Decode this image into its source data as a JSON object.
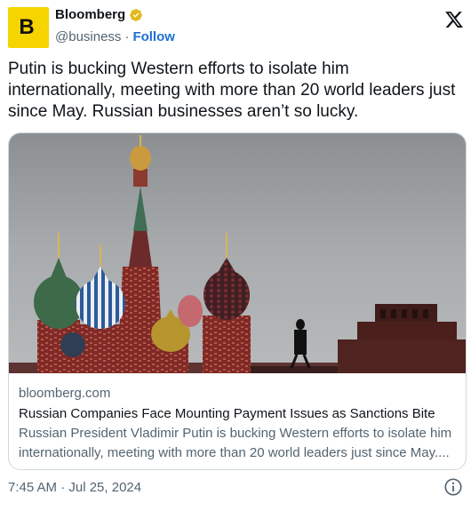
{
  "author": {
    "name": "Bloomberg",
    "handle": "@business",
    "separator": "·",
    "follow_label": "Follow",
    "avatar_letter": "B",
    "avatar_color": "#f5d400",
    "verified_color": "#e2b719"
  },
  "tweet": {
    "text": "Putin is bucking Western efforts to isolate him internationally, meeting with more than 20 world leaders just since May. Russian businesses aren’t so lucky."
  },
  "card": {
    "domain": "bloomberg.com",
    "title": "Russian Companies Face Mounting Payment Issues as Sanctions Bite",
    "description_line1": "Russian President Vladimir Putin is bucking Western efforts to isolate him",
    "description_line2": "internationally, meeting with more than 20 world leaders just since May...."
  },
  "timestamp": "7:45 AM · Jul 25, 2024",
  "icons": {
    "platform": "x-logo-icon",
    "verified": "verified-badge-icon",
    "info": "info-icon"
  },
  "colors": {
    "link": "#1d6fd1",
    "secondary_text": "#536471",
    "border": "#cfd9de"
  }
}
